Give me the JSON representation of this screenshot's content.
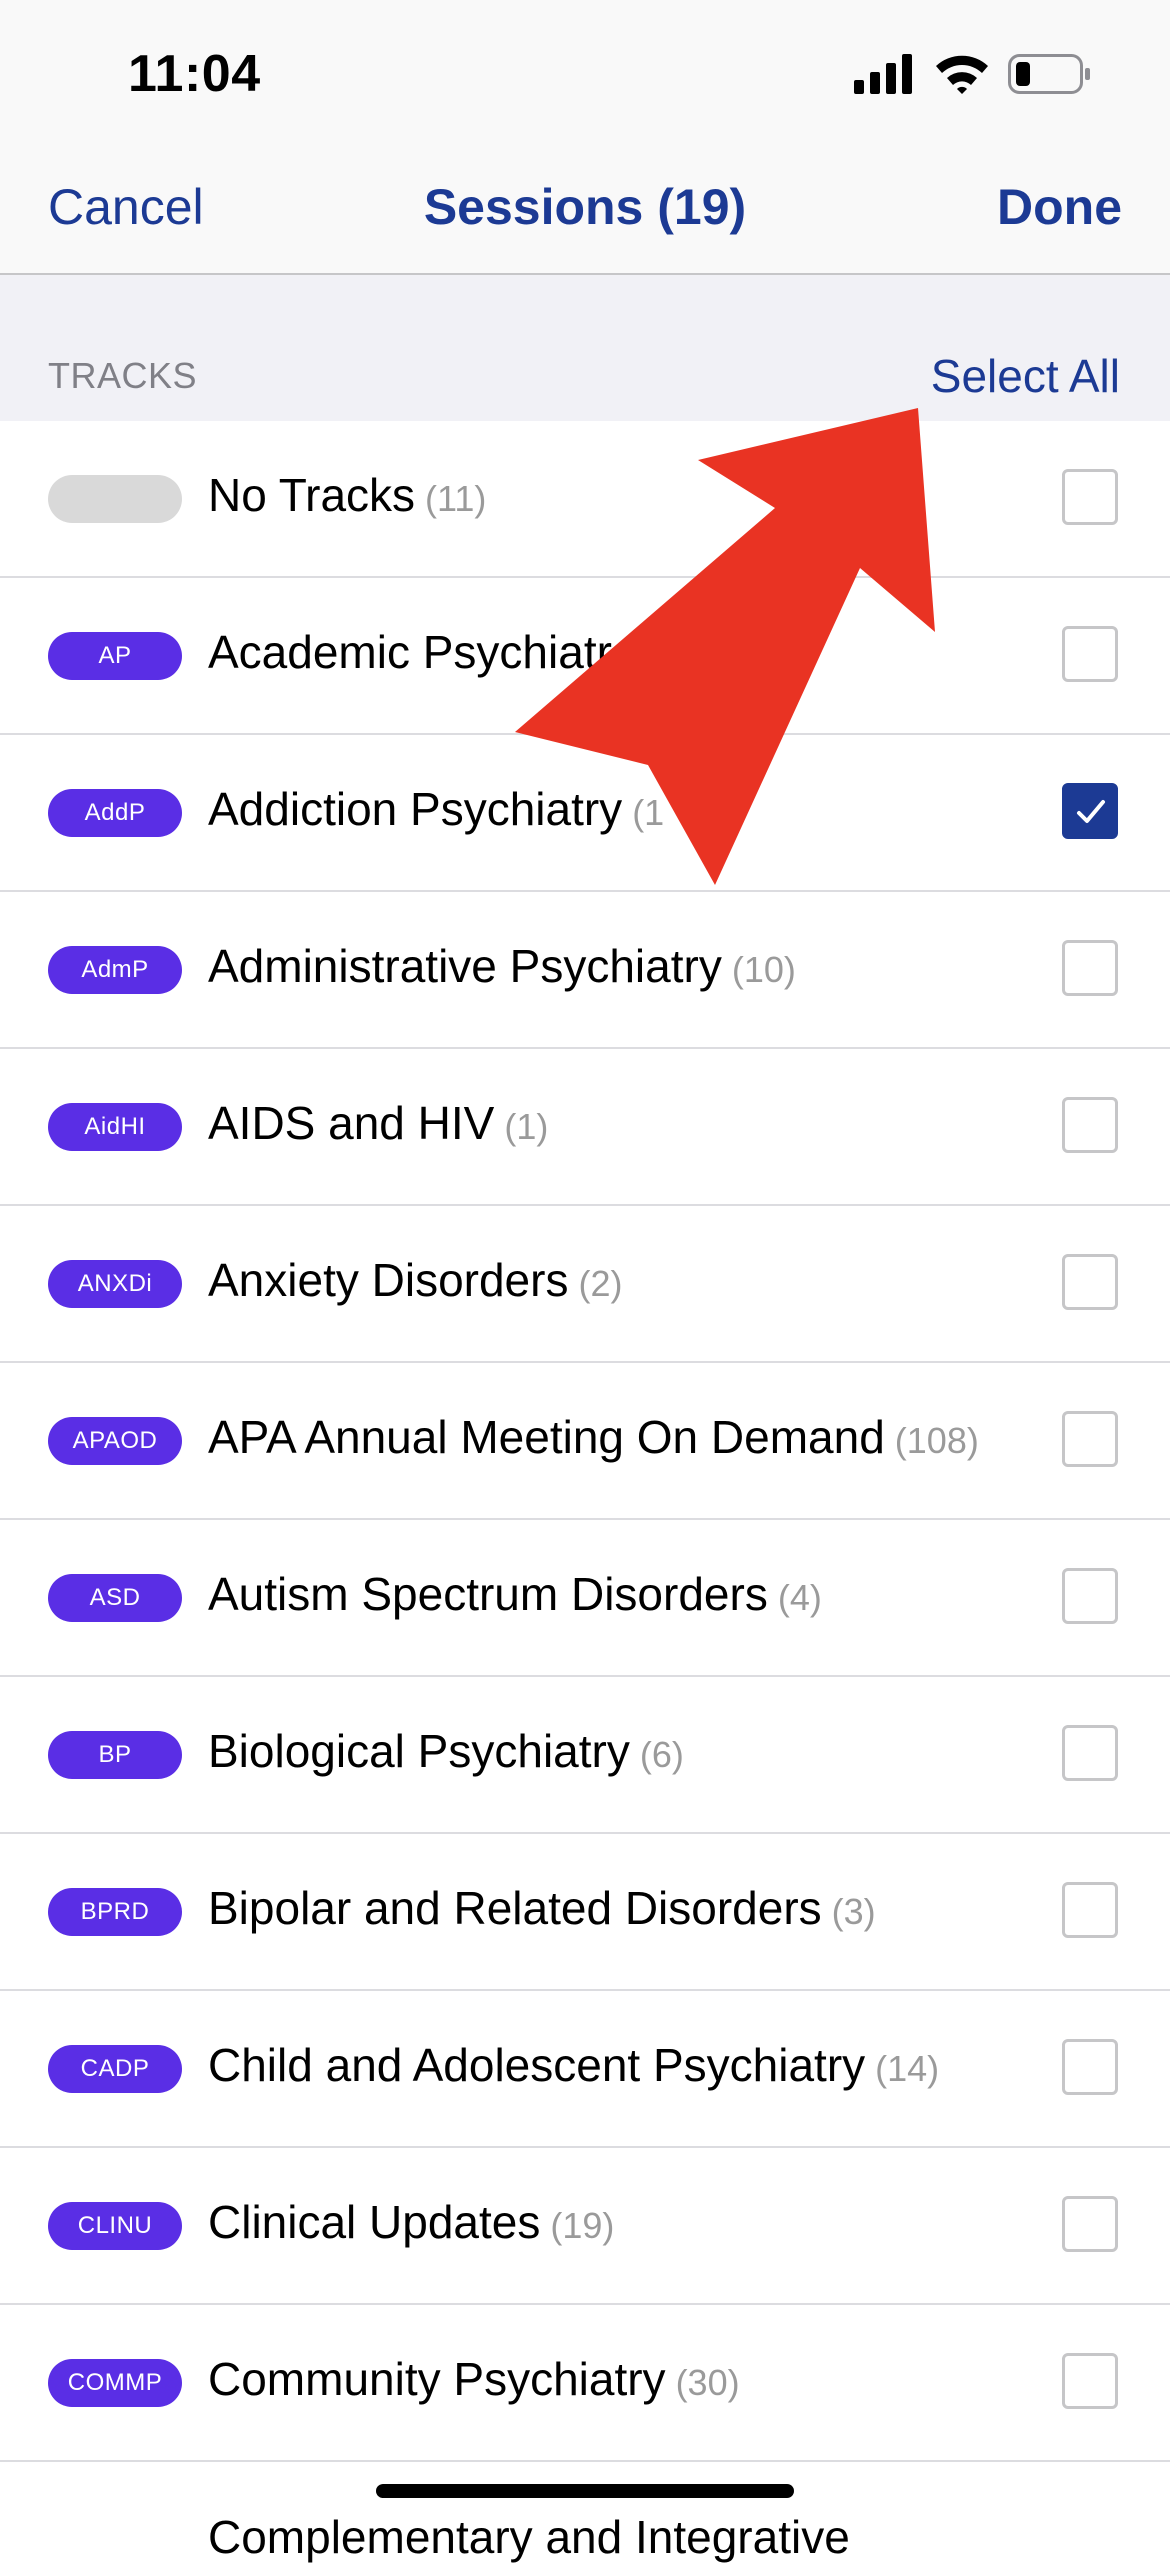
{
  "status_bar": {
    "time": "11:04"
  },
  "nav": {
    "cancel_label": "Cancel",
    "title": "Sessions (19)",
    "done_label": "Done"
  },
  "section": {
    "label": "TRACKS",
    "select_all_label": "Select All"
  },
  "tracks": [
    {
      "badge": "",
      "label": "No Tracks",
      "count": "(11)",
      "checked": false
    },
    {
      "badge": "AP",
      "label": "Academic Psychiatr",
      "count": "",
      "checked": false
    },
    {
      "badge": "AddP",
      "label": "Addiction Psychiatry",
      "count": "(1",
      "checked": true
    },
    {
      "badge": "AdmP",
      "label": "Administrative Psychiatry",
      "count": "(10)",
      "checked": false
    },
    {
      "badge": "AidHI",
      "label": "AIDS and HIV",
      "count": "(1)",
      "checked": false
    },
    {
      "badge": "ANXDi",
      "label": "Anxiety Disorders",
      "count": "(2)",
      "checked": false
    },
    {
      "badge": "APAOD",
      "label": "APA Annual Meeting On Demand",
      "count": "(108)",
      "checked": false
    },
    {
      "badge": "ASD",
      "label": "Autism Spectrum Disorders",
      "count": "(4)",
      "checked": false
    },
    {
      "badge": "BP",
      "label": "Biological Psychiatry",
      "count": "(6)",
      "checked": false
    },
    {
      "badge": "BPRD",
      "label": "Bipolar and Related Disorders",
      "count": "(3)",
      "checked": false
    },
    {
      "badge": "CADP",
      "label": "Child and Adolescent Psychiatry",
      "count": "(14)",
      "checked": false
    },
    {
      "badge": "CLINU",
      "label": "Clinical Updates",
      "count": "(19)",
      "checked": false
    },
    {
      "badge": "COMMP",
      "label": "Community Psychiatry",
      "count": "(30)",
      "checked": false
    }
  ],
  "partial_row_label": "Complementary and Integrative",
  "colors": {
    "accent": "#1c3a94",
    "badge": "#5a2ee5",
    "badge_empty": "#d9d9d9",
    "arrow": "#e93323"
  },
  "icons": {
    "signal": "signal-icon",
    "wifi": "wifi-icon",
    "battery": "battery-icon",
    "checkmark": "checkmark-icon",
    "arrow": "arrow-annotation-icon"
  }
}
